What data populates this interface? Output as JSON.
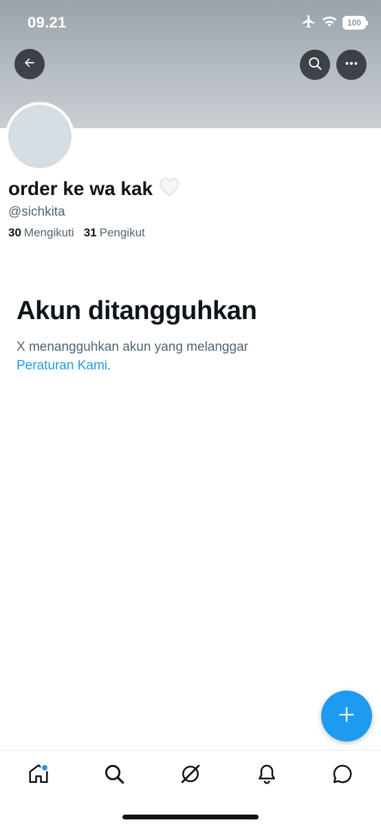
{
  "status_bar": {
    "time": "09.21",
    "battery": "100",
    "icons": [
      "airplane-icon",
      "wifi-icon",
      "battery-icon"
    ]
  },
  "header": {
    "back_icon": "arrow-left-icon",
    "search_icon": "search-icon",
    "more_icon": "more-horizontal-icon"
  },
  "profile": {
    "display_name": "order ke wa kak",
    "name_emoji": "🤍",
    "handle": "@sichkita",
    "following_count": "30",
    "following_label": "Mengikuti",
    "followers_count": "31",
    "followers_label": "Pengikut"
  },
  "suspended": {
    "title": "Akun ditangguhkan",
    "body": "X menangguhkan akun yang melanggar",
    "link": "Peraturan Kami",
    "end": "."
  },
  "fab": {
    "icon": "plus-icon"
  },
  "bottom_nav": {
    "items": [
      {
        "icon": "home-icon",
        "active": true,
        "notification_dot": true
      },
      {
        "icon": "search-icon"
      },
      {
        "icon": "grok-icon"
      },
      {
        "icon": "bell-icon"
      },
      {
        "icon": "messages-icon"
      }
    ]
  },
  "colors": {
    "accent": "#1d9bf0",
    "text_primary": "#0f1419",
    "text_secondary": "#536471",
    "avatar_placeholder": "#d6dde3"
  }
}
